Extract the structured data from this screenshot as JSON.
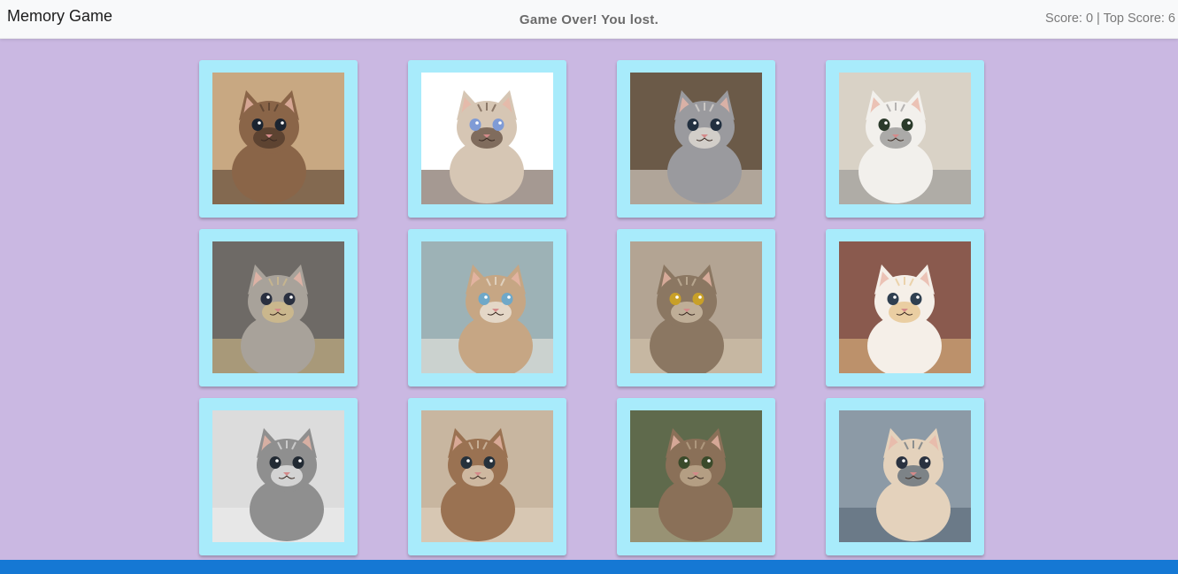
{
  "navbar": {
    "brand": "Memory Game",
    "status": "Game Over! You lost.",
    "score_text": "Score: 0 | Top Score: 6"
  },
  "colors": {
    "background": "#cab8e2",
    "card": "#a8ebfb",
    "footer": "#1578d4"
  },
  "cards": [
    {
      "name": "cat-card-brown-kitten",
      "bg": "#c8a882",
      "fur": "#8a6548",
      "accent": "#4a3528",
      "eye": "#1b2430"
    },
    {
      "name": "cat-card-grumpy-cat",
      "bg": "#ffffff",
      "fur": "#d6c6b4",
      "accent": "#5b4638",
      "eye": "#7f9bd6"
    },
    {
      "name": "cat-card-kittens-in-basket",
      "bg": "#6b5a48",
      "fur": "#9a9a9e",
      "accent": "#e9e4dc",
      "eye": "#223040"
    },
    {
      "name": "cat-card-exotic-shorthair",
      "bg": "#d9d2c6",
      "fur": "#f2f0ec",
      "accent": "#8d8c8c",
      "eye": "#2a3a2a"
    },
    {
      "name": "cat-card-kittens-on-rope",
      "bg": "#6e6a66",
      "fur": "#a8a29a",
      "accent": "#d9c088",
      "eye": "#2a3040"
    },
    {
      "name": "cat-card-two-kittens",
      "bg": "#9db2b6",
      "fur": "#c6a684",
      "accent": "#f1ece4",
      "eye": "#6fa8c8"
    },
    {
      "name": "cat-card-lying-tabby",
      "bg": "#b3a493",
      "fur": "#8b7762",
      "accent": "#d6c6ae",
      "eye": "#c8a028"
    },
    {
      "name": "cat-card-bread-cat",
      "bg": "#8a5a4e",
      "fur": "#f5efe8",
      "accent": "#e6c084",
      "eye": "#2f3f50"
    },
    {
      "name": "cat-card-striped-kitten",
      "bg": "#dcdcdc",
      "fur": "#8f8f8f",
      "accent": "#f0f0f0",
      "eye": "#222a33"
    },
    {
      "name": "cat-card-kitten-in-blanket",
      "bg": "#c8b6a0",
      "fur": "#9a7252",
      "accent": "#e4d6c2",
      "eye": "#26313b"
    },
    {
      "name": "cat-card-sitting-tabby",
      "bg": "#5f6a4c",
      "fur": "#8a7058",
      "accent": "#c6b296",
      "eye": "#3a4a2a"
    },
    {
      "name": "cat-card-kitten-on-sofa",
      "bg": "#8c9aa6",
      "fur": "#e4d2bc",
      "accent": "#516170",
      "eye": "#2a3240"
    }
  ]
}
